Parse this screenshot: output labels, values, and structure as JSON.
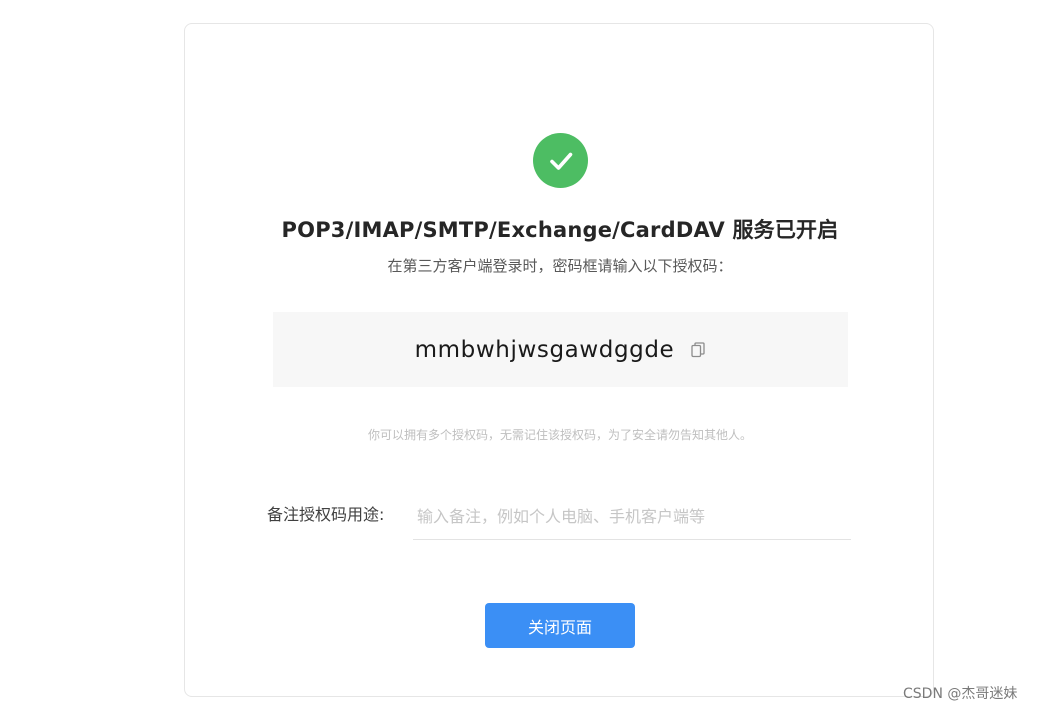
{
  "success": {
    "icon": "check-circle-icon",
    "color": "#4dbd63"
  },
  "title": "POP3/IMAP/SMTP/Exchange/CardDAV 服务已开启",
  "subtitle": "在第三方客户端登录时，密码框请输入以下授权码：",
  "auth_code": {
    "value": "mmbwhjwsgawdggde",
    "copy_icon": "copy-icon"
  },
  "hint": "你可以拥有多个授权码，无需记住该授权码，为了安全请勿告知其他人。",
  "remark": {
    "label": "备注授权码用途:",
    "placeholder": "输入备注，例如个人电脑、手机客户端等",
    "value": ""
  },
  "close_button": {
    "label": "关闭页面",
    "color": "#3b8ff5"
  },
  "watermark": "CSDN @杰哥迷妹"
}
